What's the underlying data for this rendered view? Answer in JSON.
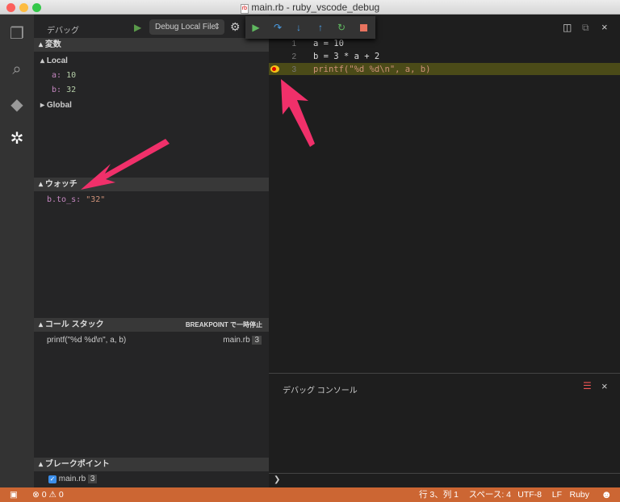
{
  "window": {
    "title": "main.rb - ruby_vscode_debug",
    "file_badge": "rb"
  },
  "sidebar": {
    "title": "デバッグ",
    "config": "Debug Local File",
    "variables": {
      "title": "変数",
      "local": "Local",
      "items": [
        {
          "name": "a:",
          "value": "10"
        },
        {
          "name": "b:",
          "value": "32"
        }
      ],
      "global": "Global"
    },
    "watch": {
      "title": "ウォッチ",
      "items": [
        {
          "expr": "b.to_s:",
          "value": "\"32\""
        }
      ]
    },
    "callstack": {
      "title": "コール スタック",
      "status": "BREAKPOINT で一時停止",
      "frames": [
        {
          "name": "printf(\"%d %d\\n\", a, b)",
          "file": "main.rb",
          "line": "3"
        }
      ]
    },
    "breakpoints": {
      "title": "ブレークポイント",
      "items": [
        {
          "file": "main.rb",
          "line": "3"
        }
      ]
    }
  },
  "editor": {
    "lines": [
      {
        "n": "1",
        "code": "a = 10"
      },
      {
        "n": "2",
        "code": "b = 3 * a + 2"
      },
      {
        "n": "3",
        "code": "printf(\"%d %d\\n\", a, b)"
      }
    ]
  },
  "panel": {
    "title": "デバッグ コンソール",
    "prompt": "❯"
  },
  "status": {
    "errors": "0",
    "warnings": "0",
    "position": "行 3、列 1",
    "spaces": "スペース: 4",
    "encoding": "UTF-8",
    "eol": "LF",
    "language": "Ruby"
  },
  "colors": {
    "status": "#cc6633",
    "arrow": "#f0306a",
    "highlight": "#4b4b18"
  }
}
